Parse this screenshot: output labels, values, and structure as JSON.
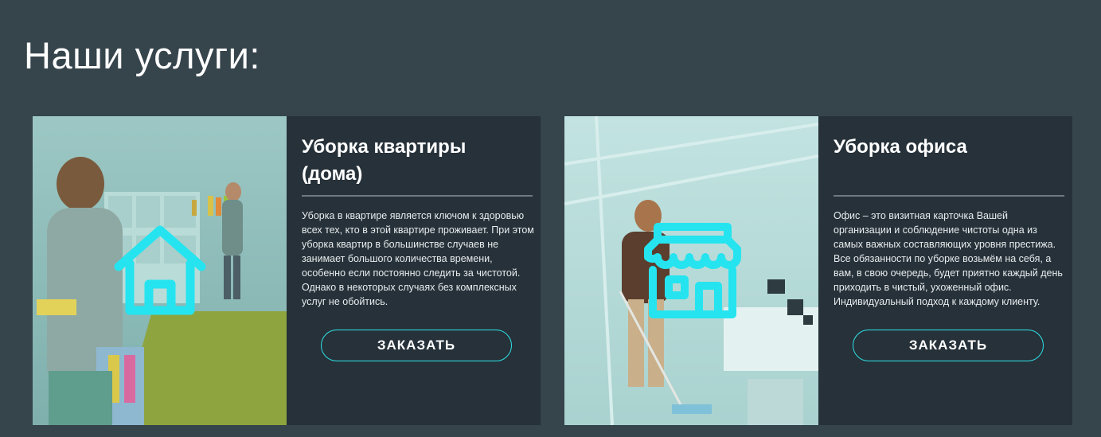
{
  "section": {
    "title": "Наши услуги:"
  },
  "cards": [
    {
      "title": "Уборка квартиры (дома)",
      "description": "Уборка в квартире является ключом к здоровью всех тех, кто в этой квартире проживает. При этом уборка квартир в большинстве случаев не занимает большого количества времени, особенно если постоянно следить за чистотой. Однако в некоторых случаях без комплексных услуг не обойтись.",
      "button": "ЗАКАЗАТЬ",
      "icon": "house-icon"
    },
    {
      "title": "Уборка офиса",
      "description": "Офис – это визитная карточка Вашей организации и соблюдение чистоты одна из самых важных составляющих уровня престижа. Все обязанности по уборке возьмём на себя, а вам, в свою очередь, будет приятно каждый день приходить в чистый, ухоженный офис. Индивидуальный подход к каждому клиенту.",
      "button": "ЗАКАЗАТЬ",
      "icon": "storefront-icon"
    }
  ],
  "colors": {
    "page_bg": "#36444c",
    "card_bg": "#263139",
    "accent": "#2fe3e8"
  }
}
